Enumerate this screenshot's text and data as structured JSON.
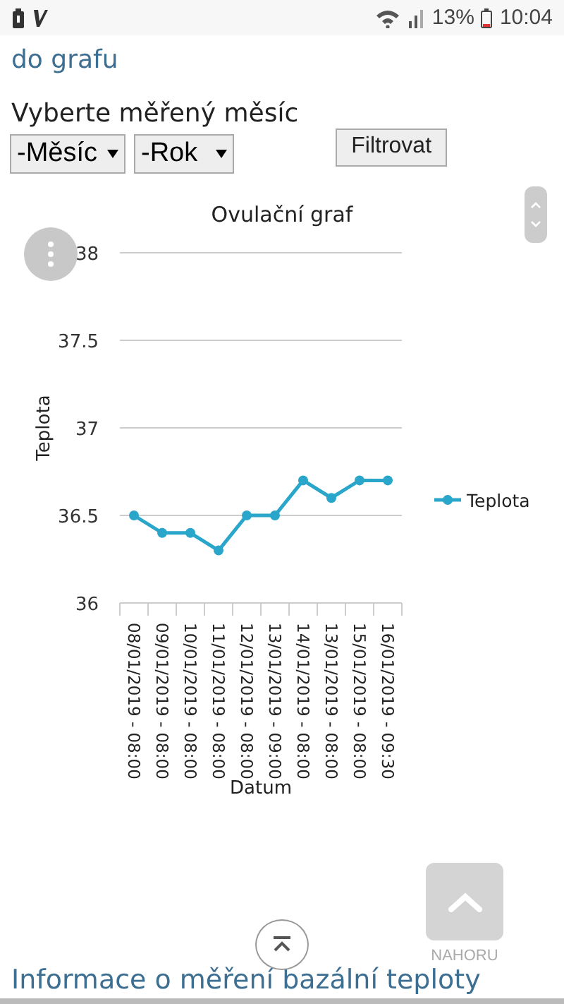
{
  "status_bar": {
    "battery": "13%",
    "time": "10:04"
  },
  "link": "do grafu",
  "heading": "Vyberte měřený měsíc",
  "filters": {
    "month": "-Měsíc",
    "year": "-Rok",
    "button": "Filtrovat"
  },
  "chart": {
    "chart_data": {
      "type": "line",
      "title": "Ovulační graf",
      "xlabel": "Datum",
      "ylabel": "Teplota",
      "categories": [
        "08/01/2019 - 08:00",
        "09/01/2019 - 08:00",
        "10/01/2019 - 08:00",
        "11/01/2019 - 08:00",
        "12/01/2019 - 08:00",
        "13/01/2019 - 09:00",
        "14/01/2019 - 08:00",
        "13/01/2019 - 08:00",
        "15/01/2019 - 08:00",
        "16/01/2019 - 09:30"
      ],
      "series": [
        {
          "name": "Teplota",
          "color": "#2ba6cb",
          "marker": "circle",
          "values": [
            36.5,
            36.4,
            36.4,
            36.3,
            36.5,
            36.5,
            36.7,
            36.6,
            36.7,
            36.7
          ]
        }
      ],
      "ylim": [
        36,
        38
      ],
      "grid": true,
      "yticks": [
        36,
        36.5,
        37,
        37.5,
        38
      ]
    }
  },
  "back_to_top": {
    "label": "NAHORU"
  },
  "section_heading": "Informace o měření bazální teploty"
}
